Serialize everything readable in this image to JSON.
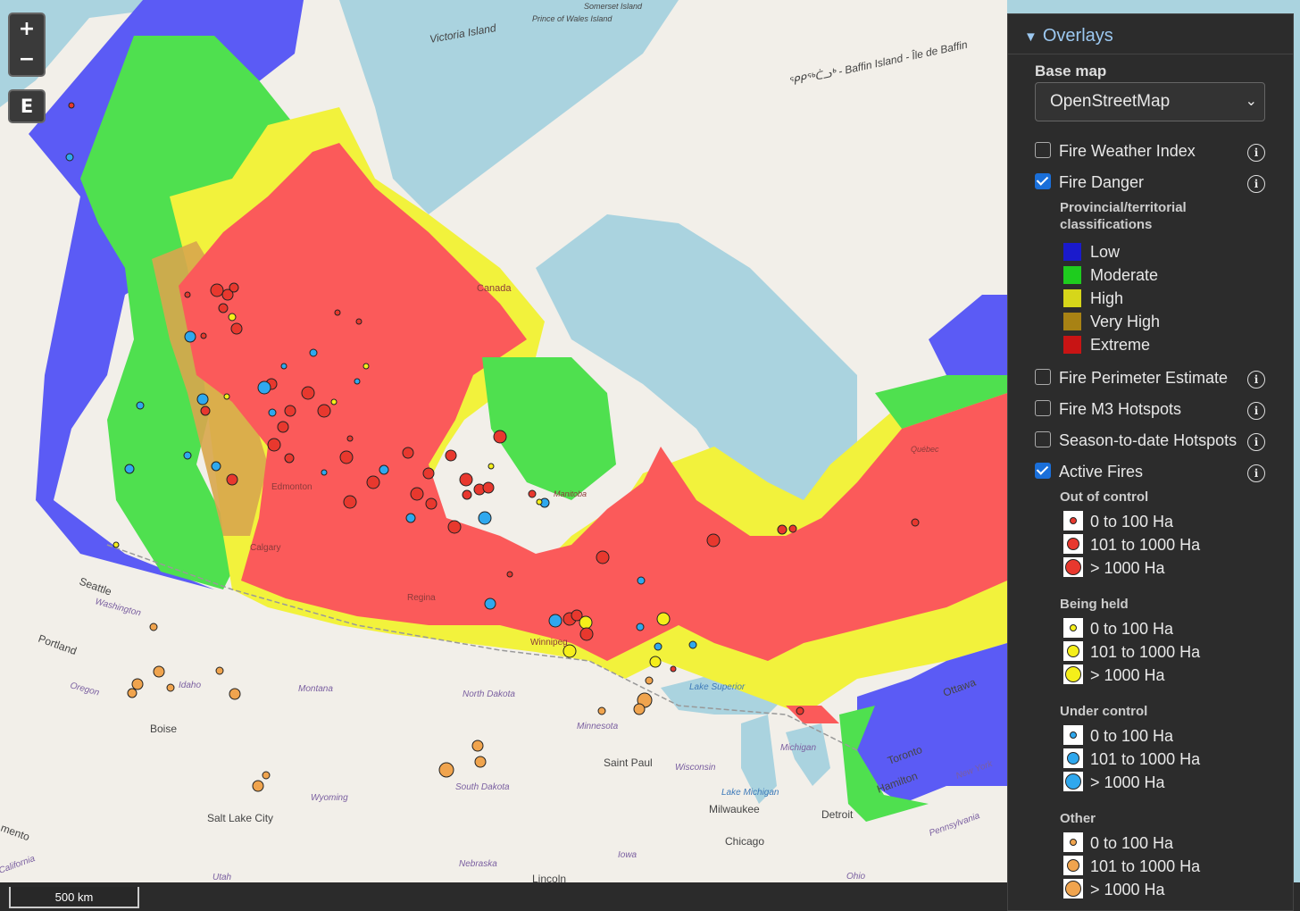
{
  "controls": {
    "zoom_in": "+",
    "zoom_out": "−",
    "edit": "E"
  },
  "scale": "500 km",
  "map_labels": {
    "victoria_island": "Victoria Island",
    "prince_of_wales": "Prince of Wales Island",
    "somerset": "Somerset Island",
    "baffin": "ᕿᑭᖅᑖᓗᒃ - Baffin Island - Île de Baffin",
    "canada": "Canada",
    "seattle": "Seattle",
    "washington": "Washington",
    "portland": "Portland",
    "oregon": "Oregon",
    "idaho": "Idaho",
    "boise": "Boise",
    "montana": "Montana",
    "wyoming": "Wyoming",
    "salt_lake_city": "Salt Lake City",
    "utah": "Utah",
    "north_dakota": "North Dakota",
    "south_dakota": "South Dakota",
    "nebraska": "Nebraska",
    "minnesota": "Minnesota",
    "saint_paul": "Saint Paul",
    "wisconsin": "Wisconsin",
    "iowa": "Iowa",
    "lincoln": "Lincoln",
    "milwaukee": "Milwaukee",
    "chicago": "Chicago",
    "lake_michigan": "Lake Michigan",
    "michigan": "Michigan",
    "detroit": "Detroit",
    "ohio": "Ohio",
    "lake_superior": "Lake Superior",
    "toronto": "Toronto",
    "hamilton": "Hamilton",
    "ottawa": "Ottawa",
    "new_york": "New York",
    "pennsylvania": "Pennsylvania",
    "edmonton": "Edmonton",
    "calgary": "Calgary",
    "regina": "Regina",
    "winnipeg": "Winnipeg",
    "manitoba": "Manitoba",
    "quebec": "Québec",
    "sacramento": "mento",
    "california": "California"
  },
  "panel": {
    "title": "Overlays",
    "base_map_label": "Base map",
    "base_map_value": "OpenStreetMap",
    "layers": [
      {
        "label": "Fire Weather Index",
        "checked": false
      },
      {
        "label": "Fire Danger",
        "checked": true
      },
      {
        "label": "Fire Perimeter Estimate",
        "checked": false
      },
      {
        "label": "Fire M3 Hotspots",
        "checked": false
      },
      {
        "label": "Season-to-date Hotspots",
        "checked": false
      },
      {
        "label": "Active Fires",
        "checked": true
      }
    ],
    "danger_heading_1": "Provincial/territorial",
    "danger_heading_2": "classifications",
    "danger_classes": [
      {
        "label": "Low",
        "color": "#1a1acc"
      },
      {
        "label": "Moderate",
        "color": "#1ecc1e"
      },
      {
        "label": "High",
        "color": "#d6d61a"
      },
      {
        "label": "Very High",
        "color": "#a88214"
      },
      {
        "label": "Extreme",
        "color": "#c81414"
      }
    ],
    "fire_groups": [
      {
        "title": "Out of control",
        "color": "#e8382e"
      },
      {
        "title": "Being held",
        "color": "#f5ef1a"
      },
      {
        "title": "Under control",
        "color": "#2fa8ee"
      },
      {
        "title": "Other",
        "color": "#f0a44e"
      }
    ],
    "size_labels": [
      "0 to 100 Ha",
      "101 to 1000 Ha",
      "> 1000 Ha"
    ]
  },
  "danger_colors": {
    "low": "#5b5bf5",
    "moderate": "#4fe04f",
    "high": "#f2f23c",
    "very_high": "#d8a64c",
    "extreme": "#fb5a5a",
    "water": "#aad3df",
    "land": "#f2efe9"
  }
}
